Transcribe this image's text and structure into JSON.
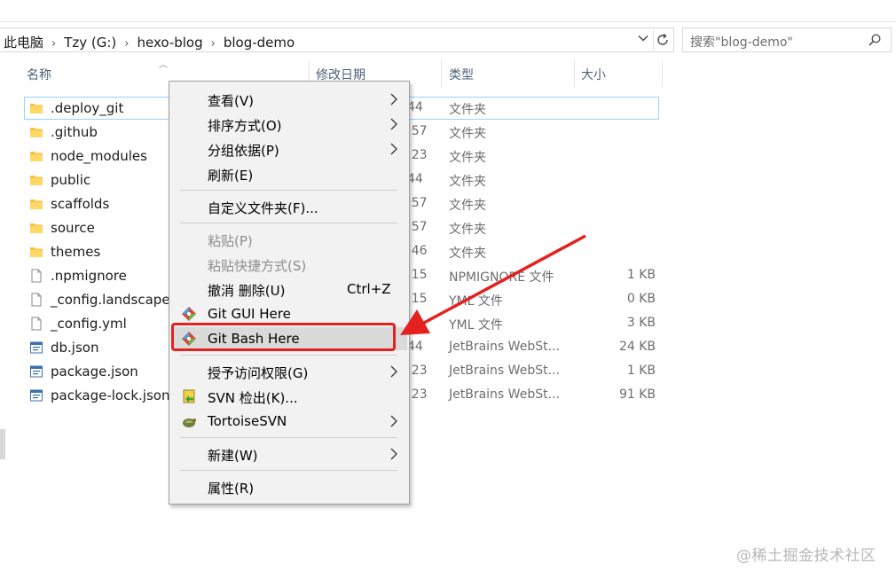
{
  "address": {
    "crumbs": [
      "此电脑",
      "Tzy (G:)",
      "hexo-blog",
      "blog-demo"
    ]
  },
  "search": {
    "placeholder": "搜索\"blog-demo\""
  },
  "columns": {
    "name": "名称",
    "date": "修改日期",
    "type": "类型",
    "size": "大小"
  },
  "files": [
    {
      "name": ".deploy_git",
      "date": "44",
      "type": "文件夹",
      "size": "",
      "icon": "folder-icon"
    },
    {
      "name": ".github",
      "date": ":57",
      "type": "文件夹",
      "size": "",
      "icon": "folder-icon"
    },
    {
      "name": "node_modules",
      "date": ":23",
      "type": "文件夹",
      "size": "",
      "icon": "folder-icon"
    },
    {
      "name": "public",
      "date": "44",
      "type": "文件夹",
      "size": "",
      "icon": "folder-icon"
    },
    {
      "name": "scaffolds",
      "date": ":57",
      "type": "文件夹",
      "size": "",
      "icon": "folder-icon"
    },
    {
      "name": "source",
      "date": ":57",
      "type": "文件夹",
      "size": "",
      "icon": "folder-icon"
    },
    {
      "name": "themes",
      "date": ":46",
      "type": "文件夹",
      "size": "",
      "icon": "folder-icon"
    },
    {
      "name": ".npmignore",
      "date": ":15",
      "type": "NPMIGNORE 文件",
      "size": "1 KB",
      "icon": "file-icon"
    },
    {
      "name": "_config.landscape.",
      "date": ":15",
      "type": "YML 文件",
      "size": "0 KB",
      "icon": "file-icon"
    },
    {
      "name": "_config.yml",
      "date": "",
      "type": "YML 文件",
      "size": "3 KB",
      "icon": "file-icon"
    },
    {
      "name": "db.json",
      "date": "44",
      "type": "JetBrains WebSt...",
      "size": "24 KB",
      "icon": "json-file-icon"
    },
    {
      "name": "package.json",
      "date": ":23",
      "type": "JetBrains WebSt...",
      "size": "1 KB",
      "icon": "json-file-icon"
    },
    {
      "name": "package-lock.json",
      "date": ":23",
      "type": "JetBrains WebSt...",
      "size": "91 KB",
      "icon": "json-file-icon"
    }
  ],
  "context_menu": {
    "view": "查看(V)",
    "sort": "排序方式(O)",
    "group": "分组依据(P)",
    "refresh": "刷新(E)",
    "customize": "自定义文件夹(F)...",
    "paste": "粘贴(P)",
    "paste_shortcut": "粘贴快捷方式(S)",
    "undo": "撤消 删除(U)",
    "undo_shortcut": "Ctrl+Z",
    "git_gui": "Git GUI Here",
    "git_bash": "Git Bash Here",
    "grant_access": "授予访问权限(G)",
    "svn_checkout": "SVN 检出(K)...",
    "tortoise": "TortoiseSVN",
    "new": "新建(W)",
    "properties": "属性(R)"
  },
  "watermark": "@稀土掘金技术社区",
  "colors": {
    "highlight": "#e3221f",
    "selection_border": "#99d1ff",
    "folder": "#f4c542"
  }
}
